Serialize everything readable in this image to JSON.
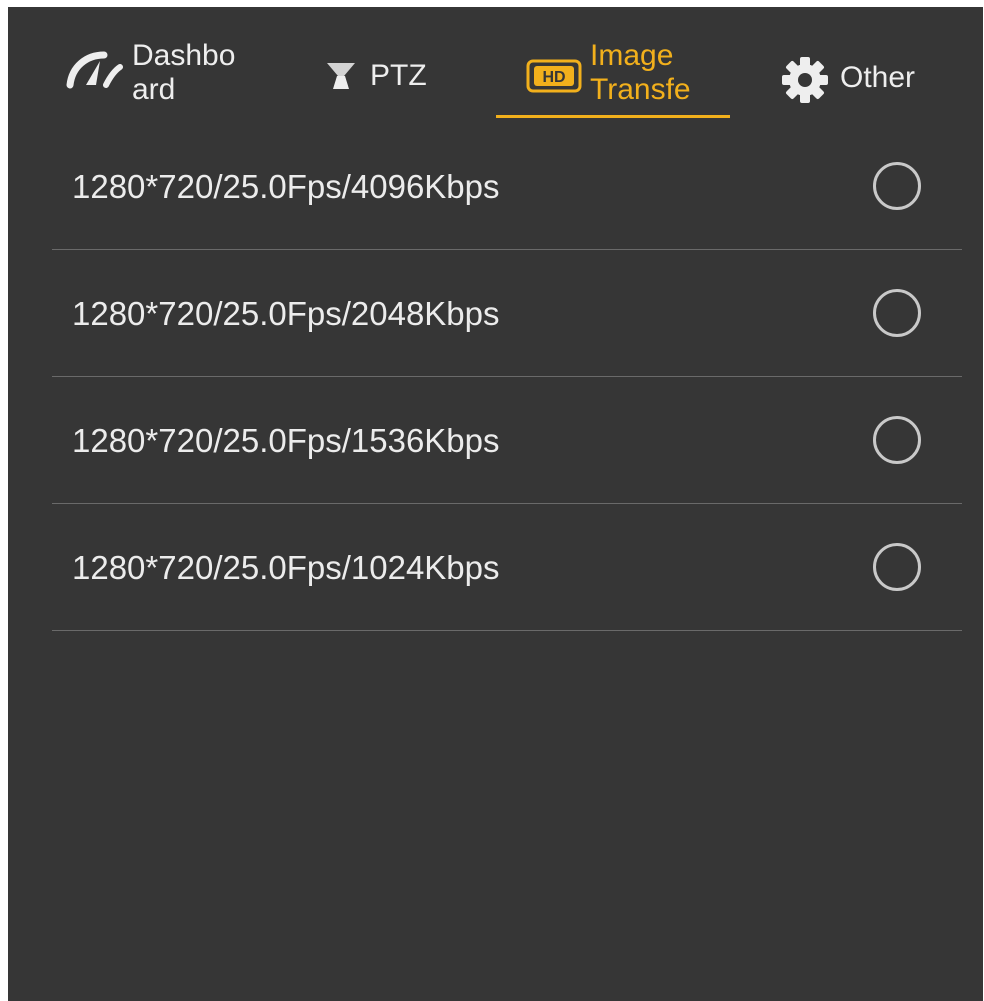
{
  "tabs": [
    {
      "label": "Dashbo\nard",
      "icon": "speedometer-icon",
      "active": false
    },
    {
      "label": "PTZ",
      "icon": "gimbal-icon",
      "active": false
    },
    {
      "label": "Image\nTransfe",
      "icon": "hd-icon",
      "active": true
    },
    {
      "label": "Other",
      "icon": "gear-icon",
      "active": false
    }
  ],
  "accent_color": "#f2b01c",
  "background_color": "#363636",
  "options": [
    {
      "label": "1280*720/25.0Fps/4096Kbps",
      "selected": false
    },
    {
      "label": "1280*720/25.0Fps/2048Kbps",
      "selected": false
    },
    {
      "label": "1280*720/25.0Fps/1536Kbps",
      "selected": false
    },
    {
      "label": "1280*720/25.0Fps/1024Kbps",
      "selected": false
    }
  ]
}
